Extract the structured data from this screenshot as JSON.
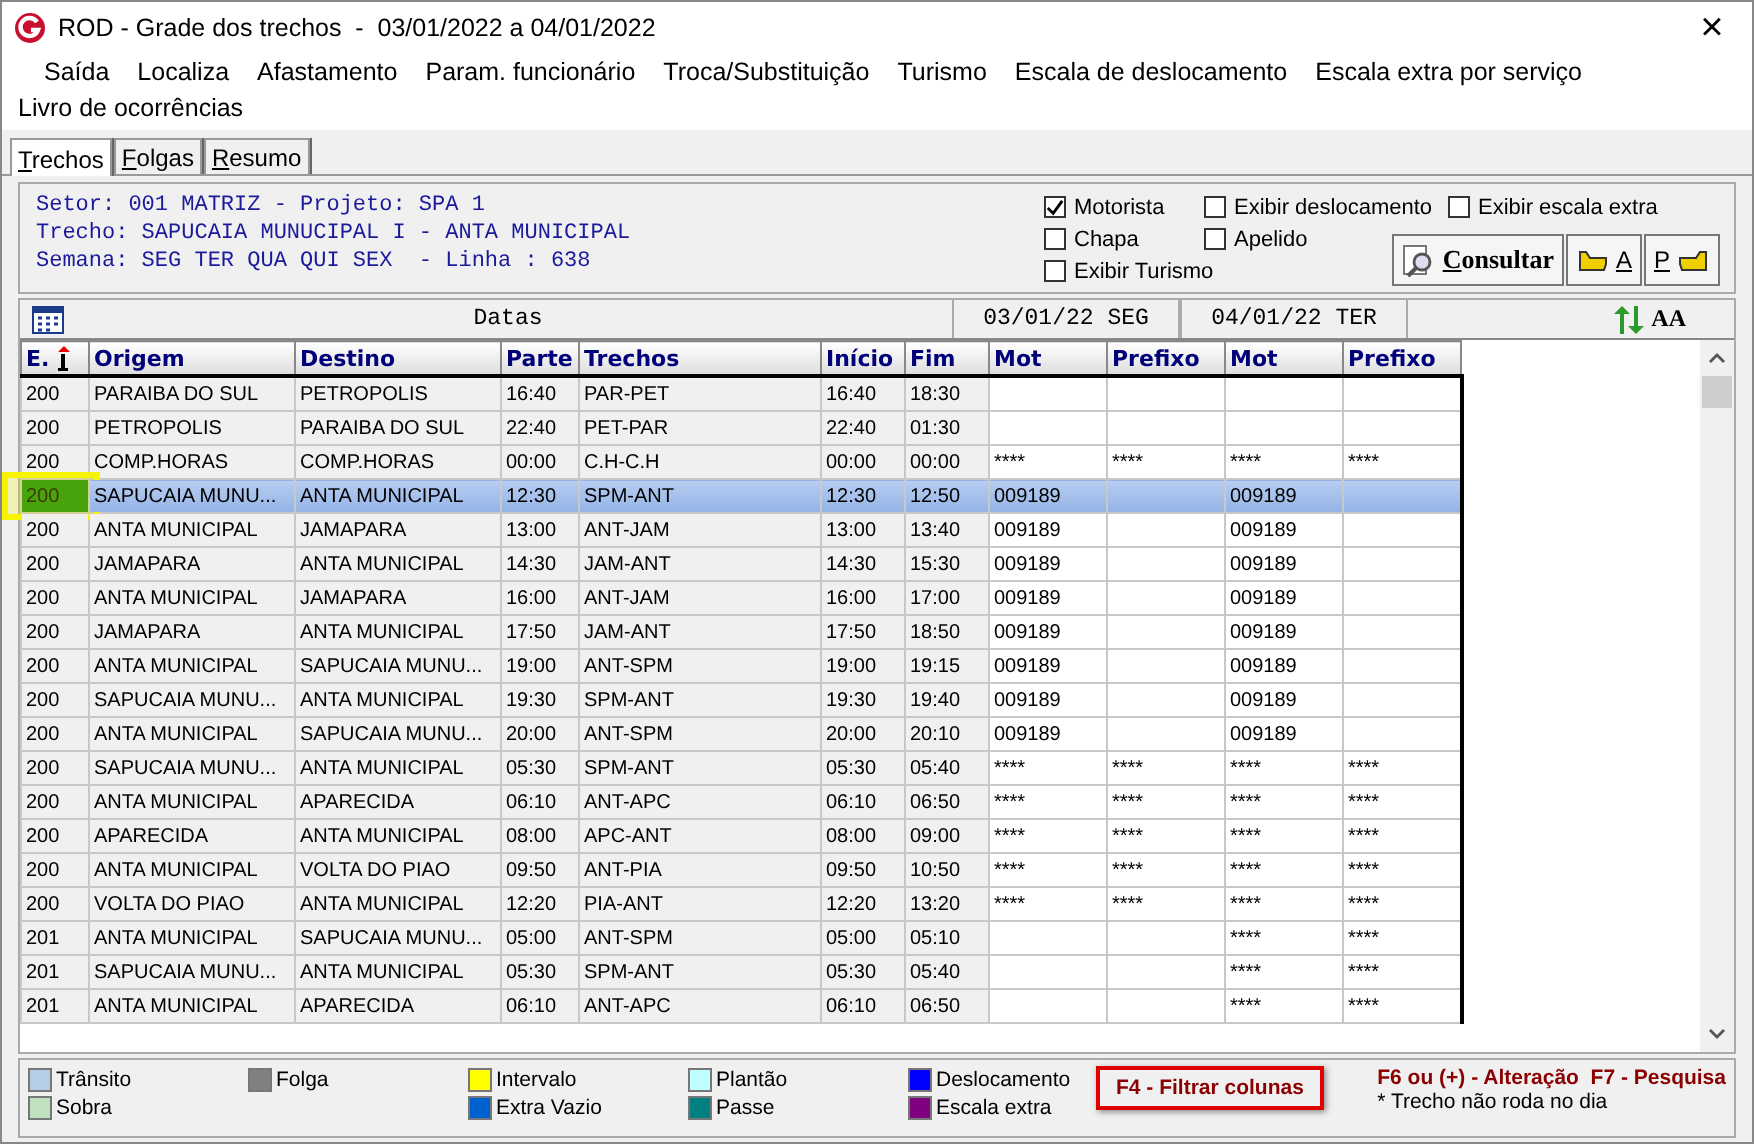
{
  "window": {
    "title": "ROD - Grade dos trechos  -  03/01/2022 a 04/01/2022",
    "close": "×"
  },
  "menu": [
    "Saída",
    "Localiza",
    "Afastamento",
    "Param. funcionário",
    "Troca/Substituição",
    "Turismo",
    "Escala de deslocamento",
    "Escala extra por serviço",
    "Livro de ocorrências"
  ],
  "tabs": [
    {
      "label": "Trechos",
      "selected": true
    },
    {
      "label": "Folgas",
      "selected": false
    },
    {
      "label": "Resumo",
      "selected": false
    }
  ],
  "info": [
    "Setor: 001 MATRIZ - Projeto: SPA 1",
    "Trecho: SAPUCAIA MUNUCIPAL I - ANTA MUNICIPAL",
    "Semana: SEG TER QUA QUI SEX  - Linha : 638"
  ],
  "options": [
    {
      "label": "Motorista",
      "checked": true
    },
    {
      "label": "Exibir deslocamento",
      "checked": false
    },
    {
      "label": "Exibir escala extra",
      "checked": false
    },
    {
      "label": "Chapa",
      "checked": false
    },
    {
      "label": "Apelido",
      "checked": false
    },
    {
      "label": "Exibir Turismo",
      "checked": false
    }
  ],
  "buttons": {
    "consultar": "Consultar",
    "prev": "A",
    "next": "P"
  },
  "dates_bar": {
    "label": "Datas",
    "dates": [
      "03/01/22 SEG",
      "04/01/22 TER"
    ],
    "font_icon": "AA"
  },
  "table": {
    "columns": [
      "E.",
      "Origem",
      "Destino",
      "Parte",
      "Trechos",
      "Início",
      "Fim",
      "Mot",
      "Prefixo",
      "Mot",
      "Prefixo"
    ],
    "rows": [
      {
        "selected": false,
        "cells": [
          "200",
          "PARAIBA DO SUL",
          "PETROPOLIS",
          "16:40",
          "PAR-PET",
          "16:40",
          "18:30",
          null,
          null,
          null,
          null
        ]
      },
      {
        "selected": false,
        "cells": [
          "200",
          "PETROPOLIS",
          "PARAIBA DO SUL",
          "22:40",
          "PET-PAR",
          "22:40",
          "01:30",
          null,
          null,
          null,
          null
        ]
      },
      {
        "selected": false,
        "cells": [
          "200",
          "COMP.HORAS",
          "COMP.HORAS",
          "00:00",
          "C.H-C.H",
          "00:00",
          "00:00",
          "****",
          "****",
          "****",
          "****"
        ]
      },
      {
        "selected": true,
        "marked": true,
        "cells": [
          "200",
          "SAPUCAIA MUNU...",
          "ANTA MUNICIPAL",
          "12:30",
          "SPM-ANT",
          "12:30",
          "12:50",
          "009189",
          null,
          "009189",
          null
        ]
      },
      {
        "selected": false,
        "cells": [
          "200",
          "ANTA MUNICIPAL",
          "JAMAPARA",
          "13:00",
          "ANT-JAM",
          "13:00",
          "13:40",
          "009189",
          null,
          "009189",
          null
        ]
      },
      {
        "selected": false,
        "cells": [
          "200",
          "JAMAPARA",
          "ANTA MUNICIPAL",
          "14:30",
          "JAM-ANT",
          "14:30",
          "15:30",
          "009189",
          null,
          "009189",
          null
        ]
      },
      {
        "selected": false,
        "cells": [
          "200",
          "ANTA MUNICIPAL",
          "JAMAPARA",
          "16:00",
          "ANT-JAM",
          "16:00",
          "17:00",
          "009189",
          null,
          "009189",
          null
        ]
      },
      {
        "selected": false,
        "cells": [
          "200",
          "JAMAPARA",
          "ANTA MUNICIPAL",
          "17:50",
          "JAM-ANT",
          "17:50",
          "18:50",
          "009189",
          null,
          "009189",
          null
        ]
      },
      {
        "selected": false,
        "cells": [
          "200",
          "ANTA MUNICIPAL",
          "SAPUCAIA MUNU...",
          "19:00",
          "ANT-SPM",
          "19:00",
          "19:15",
          "009189",
          null,
          "009189",
          null
        ]
      },
      {
        "selected": false,
        "cells": [
          "200",
          "SAPUCAIA MUNU...",
          "ANTA MUNICIPAL",
          "19:30",
          "SPM-ANT",
          "19:30",
          "19:40",
          "009189",
          null,
          "009189",
          null
        ]
      },
      {
        "selected": false,
        "cells": [
          "200",
          "ANTA MUNICIPAL",
          "SAPUCAIA MUNU...",
          "20:00",
          "ANT-SPM",
          "20:00",
          "20:10",
          "009189",
          null,
          "009189",
          null
        ]
      },
      {
        "selected": false,
        "cells": [
          "200",
          "SAPUCAIA MUNU...",
          "ANTA MUNICIPAL",
          "05:30",
          "SPM-ANT",
          "05:30",
          "05:40",
          "****",
          "****",
          "****",
          "****"
        ]
      },
      {
        "selected": false,
        "cells": [
          "200",
          "ANTA MUNICIPAL",
          "APARECIDA",
          "06:10",
          "ANT-APC",
          "06:10",
          "06:50",
          "****",
          "****",
          "****",
          "****"
        ]
      },
      {
        "selected": false,
        "cells": [
          "200",
          "APARECIDA",
          "ANTA MUNICIPAL",
          "08:00",
          "APC-ANT",
          "08:00",
          "09:00",
          "****",
          "****",
          "****",
          "****"
        ]
      },
      {
        "selected": false,
        "cells": [
          "200",
          "ANTA MUNICIPAL",
          "VOLTA DO PIAO",
          "09:50",
          "ANT-PIA",
          "09:50",
          "10:50",
          "****",
          "****",
          "****",
          "****"
        ]
      },
      {
        "selected": false,
        "cells": [
          "200",
          "VOLTA DO PIAO",
          "ANTA MUNICIPAL",
          "12:20",
          "PIA-ANT",
          "12:20",
          "13:20",
          "****",
          "****",
          "****",
          "****"
        ]
      },
      {
        "selected": false,
        "cells": [
          "201",
          "ANTA MUNICIPAL",
          "SAPUCAIA MUNU...",
          "05:00",
          "ANT-SPM",
          "05:00",
          "05:10",
          null,
          null,
          "****",
          "****"
        ]
      },
      {
        "selected": false,
        "cells": [
          "201",
          "SAPUCAIA MUNU...",
          "ANTA MUNICIPAL",
          "05:30",
          "SPM-ANT",
          "05:30",
          "05:40",
          null,
          null,
          "****",
          "****"
        ]
      },
      {
        "selected": false,
        "cells": [
          "201",
          "ANTA MUNICIPAL",
          "APARECIDA",
          "06:10",
          "ANT-APC",
          "06:10",
          "06:50",
          null,
          null,
          "****",
          "****"
        ]
      }
    ]
  },
  "legend": [
    {
      "label": "Trânsito",
      "color": "#b4cde8"
    },
    {
      "label": "Folga",
      "color": "#808080"
    },
    {
      "label": "Intervalo",
      "color": "#ffff00"
    },
    {
      "label": "Plantão",
      "color": "#c0ffff"
    },
    {
      "label": "Deslocamento",
      "color": "#0000ff"
    },
    {
      "label": "Sobra",
      "color": "#c0e0c0"
    },
    {
      "label": "Extra Vazio",
      "color": "#0060d0"
    },
    {
      "label": "Passe",
      "color": "#008080"
    },
    {
      "label": "Escala extra",
      "color": "#800080"
    }
  ],
  "shortcuts": {
    "filter": {
      "text": "F4 - Filtrar colunas",
      "marked": true
    },
    "keys": "F6 ou (+) - Alteração  F7 - Pesquisa",
    "note": "* Trecho não roda no dia"
  }
}
